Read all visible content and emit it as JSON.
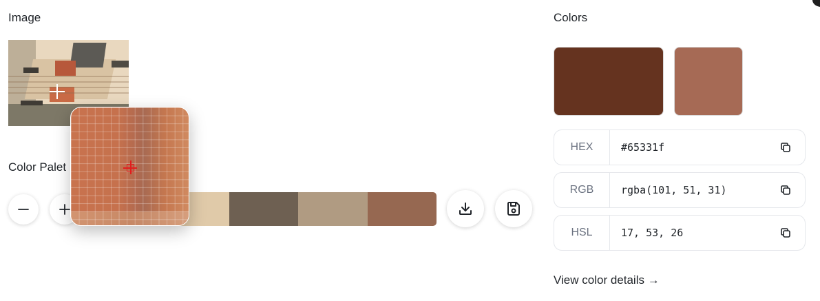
{
  "sections": {
    "image_title": "Image",
    "palette_title": "Color Palet",
    "colors_title": "Colors"
  },
  "palette": {
    "swatches": [
      "#e0caa9",
      "#e0caa9",
      "#6e6052",
      "#b09b82",
      "#966851"
    ]
  },
  "colors": {
    "primary": "#65331f",
    "secondary": "#a66a55",
    "rows": [
      {
        "label": "HEX",
        "value": "#65331f"
      },
      {
        "label": "RGB",
        "value": "rgba(101, 51, 31)"
      },
      {
        "label": "HSL",
        "value": "17, 53, 26"
      }
    ],
    "details_link": "View color details →"
  },
  "icons": {
    "minus": "minus-icon",
    "plus": "plus-icon",
    "download": "download-icon",
    "save": "save-icon",
    "copy": "copy-icon"
  }
}
